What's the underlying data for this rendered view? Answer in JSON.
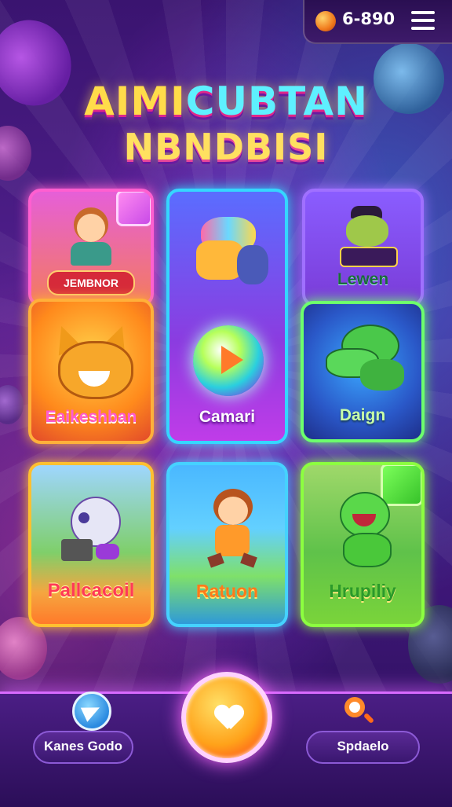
{
  "header": {
    "coin_count": "6-890",
    "coin_icon": "coin-icon",
    "menu_icon": "hamburger-menu-icon"
  },
  "title": {
    "line1_part1": "AIMI",
    "line1_part2": "CUBTAN",
    "line2": "NBNDBISI"
  },
  "games": [
    {
      "id": "jembnor",
      "label": "JEMBNOR",
      "art": "boy-character"
    },
    {
      "id": "eaikeshban",
      "label": "Eaikeshban",
      "art": "orange-fox"
    },
    {
      "id": "camari",
      "label": "Camari",
      "art": "rainbow-horse-and-play-orb"
    },
    {
      "id": "lewen",
      "label": "Lewen",
      "art": "hat-creature"
    },
    {
      "id": "daign",
      "label": "Daign",
      "art": "green-dragon"
    },
    {
      "id": "pallcacoil",
      "label": "Pallcacoil",
      "art": "robot-in-park"
    },
    {
      "id": "ratuon",
      "label": "Ratuon",
      "art": "running-girl"
    },
    {
      "id": "hrupiliy",
      "label": "Hrupiliy",
      "art": "green-monster"
    }
  ],
  "bottom_nav": {
    "left_label": "Kanes Godo",
    "left_icon": "paper-plane-icon",
    "center_icon": "heart-icon",
    "right_label": "Spdaelo",
    "right_icon": "search-icon"
  },
  "colors": {
    "background": "#52208f",
    "accent_pink": "#ff5fd0",
    "accent_cyan": "#35d6ff",
    "accent_green": "#6dff6d",
    "accent_orange": "#ffb03a"
  }
}
